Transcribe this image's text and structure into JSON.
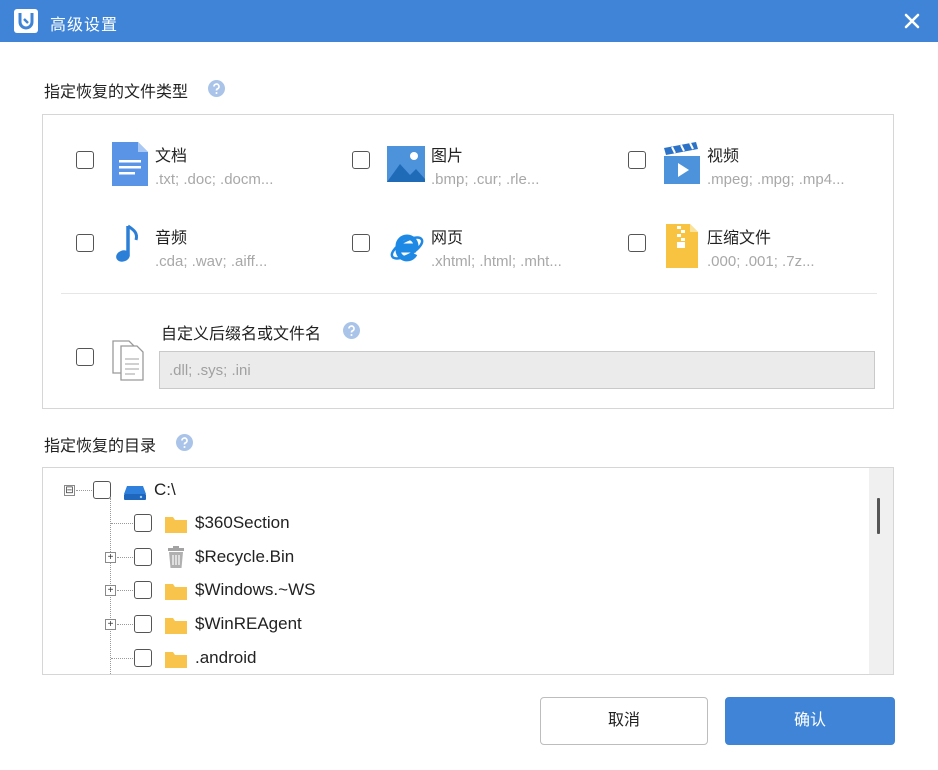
{
  "window": {
    "title": "高级设置"
  },
  "file_types": {
    "heading": "指定恢复的文件类型",
    "items": [
      {
        "name": "文档",
        "extensions": ".txt; .doc; .docm...",
        "icon": "document-icon"
      },
      {
        "name": "图片",
        "extensions": ".bmp; .cur; .rle...",
        "icon": "image-icon"
      },
      {
        "name": "视频",
        "extensions": ".mpeg; .mpg; .mp4...",
        "icon": "video-icon"
      },
      {
        "name": "音频",
        "extensions": ".cda; .wav; .aiff...",
        "icon": "music-note-icon"
      },
      {
        "name": "网页",
        "extensions": ".xhtml; .html; .mht...",
        "icon": "web-browser-icon"
      },
      {
        "name": "压缩文件",
        "extensions": ".000; .001; .7z...",
        "icon": "archive-icon"
      }
    ],
    "custom": {
      "label": "自定义后缀名或文件名",
      "placeholder": ".dll; .sys; .ini"
    }
  },
  "directory": {
    "heading": "指定恢复的目录",
    "root": {
      "label": "C:\\",
      "expander": "⊟"
    },
    "children": [
      {
        "label": "$360Section",
        "icon": "folder-icon",
        "expander": ""
      },
      {
        "label": "$Recycle.Bin",
        "icon": "recycle-bin-icon",
        "expander": "+"
      },
      {
        "label": "$Windows.~WS",
        "icon": "folder-icon",
        "expander": "+"
      },
      {
        "label": "$WinREAgent",
        "icon": "folder-icon",
        "expander": "+"
      },
      {
        "label": ".android",
        "icon": "folder-icon",
        "expander": ""
      }
    ]
  },
  "buttons": {
    "cancel": "取消",
    "ok": "确认"
  },
  "colors": {
    "accent": "#3f84d6",
    "folder": "#f8c44c",
    "help": "#a9c4e8",
    "muted_text": "#a8a8a8"
  }
}
